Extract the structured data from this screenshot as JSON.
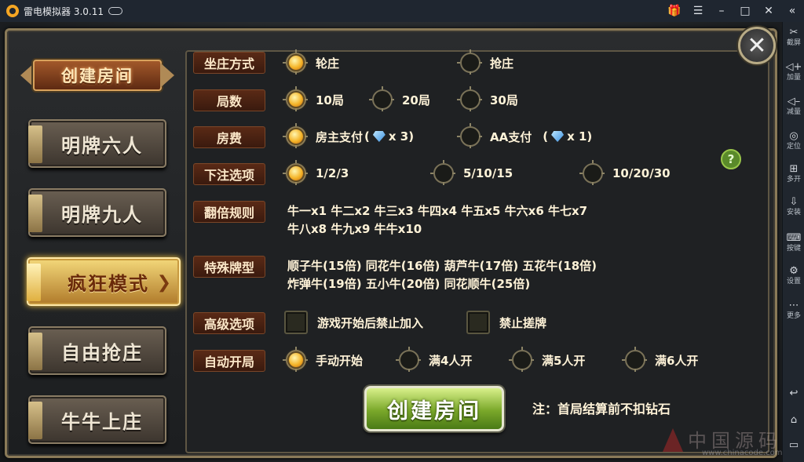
{
  "window": {
    "title": "雷电模拟器 3.0.11",
    "controls": {
      "gift": "gift-icon",
      "menu": "☰",
      "minimize": "–",
      "maximize": "□",
      "close": "✕",
      "collapse": "«"
    }
  },
  "sidebar": {
    "items": [
      {
        "icon": "✂",
        "label": "截屏"
      },
      {
        "icon": "◁+",
        "label": "加量"
      },
      {
        "icon": "◁–",
        "label": "减量"
      },
      {
        "icon": "◎",
        "label": "定位"
      },
      {
        "icon": "⊞",
        "label": "多开"
      },
      {
        "icon": "⇩",
        "label": "安装"
      },
      {
        "icon": "⌨",
        "label": "按键"
      },
      {
        "icon": "⚙",
        "label": "设置"
      },
      {
        "icon": "⋯",
        "label": "更多"
      }
    ],
    "bottom": {
      "back": "↩",
      "home": "⌂",
      "recent": "▭"
    }
  },
  "left": {
    "create_tab": "创建房间",
    "modes": [
      "明牌六人",
      "明牌九人",
      "疯狂模式",
      "自由抢庄",
      "牛牛上庄"
    ],
    "active_mode": "疯狂模式"
  },
  "rows": {
    "banker": {
      "label": "坐庄方式",
      "options": [
        "轮庄",
        "抢庄"
      ],
      "selected": "轮庄"
    },
    "rounds": {
      "label": "局数",
      "options": [
        "10局",
        "20局",
        "30局"
      ],
      "selected": "10局"
    },
    "fee": {
      "label": "房费",
      "options": [
        "房主支付",
        "AA支付"
      ],
      "costs": [
        "x 3)",
        "x 1)"
      ],
      "selected": "房主支付"
    },
    "bet": {
      "label": "下注选项",
      "options": [
        "1/2/3",
        "5/10/15",
        "10/20/30"
      ],
      "selected": "1/2/3"
    },
    "multiplier": {
      "label": "翻倍规则",
      "line1": "牛一x1  牛二x2  牛三x3  牛四x4  牛五x5  牛六x6  牛七x7",
      "line2": "牛八x8  牛九x9  牛牛x10"
    },
    "special": {
      "label": "特殊牌型",
      "line1": "顺子牛(15倍)  同花牛(16倍)  葫芦牛(17倍)  五花牛(18倍)",
      "line2": "炸弹牛(19倍)  五小牛(20倍)  同花顺牛(25倍)"
    },
    "advanced": {
      "label": "高级选项",
      "options": [
        "游戏开始后禁止加入",
        "禁止搓牌"
      ]
    },
    "auto_start": {
      "label": "自动开局",
      "options": [
        "手动开始",
        "满4人开",
        "满5人开",
        "满6人开"
      ],
      "selected": "手动开始"
    }
  },
  "create_button": "创建房间",
  "note": "注：首局结算前不扣钻石",
  "watermark": {
    "text": "中国源码",
    "url": "www.chinacode.com"
  },
  "colors": {
    "accent_gold": "#f5b52a",
    "label_bg": "#5a2a16",
    "create_green": "#7aa82a"
  }
}
